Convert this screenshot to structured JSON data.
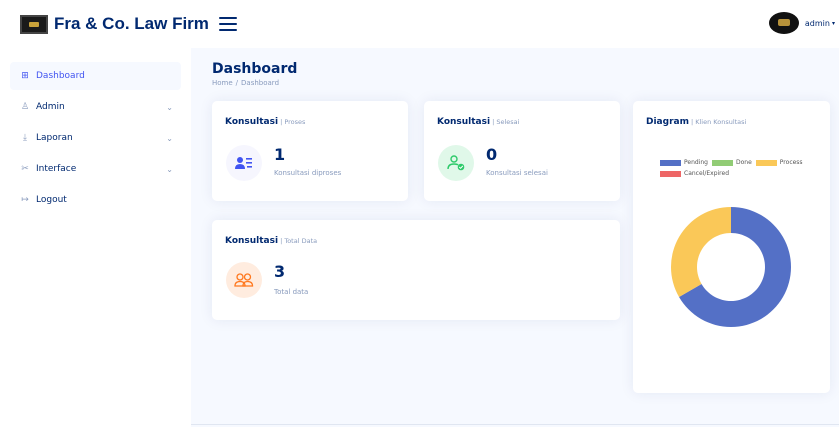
{
  "header": {
    "brand": "Fra & Co. Law Firm",
    "user": "admin",
    "user_caret": "▾"
  },
  "sidebar": {
    "items": [
      {
        "icon": "⊞",
        "label": "Dashboard",
        "chevron": ""
      },
      {
        "icon": "♙",
        "label": "Admin",
        "chevron": "⌄"
      },
      {
        "icon": "⤓",
        "label": "Laporan",
        "chevron": "⌄"
      },
      {
        "icon": "✂",
        "label": "Interface",
        "chevron": "⌄"
      },
      {
        "icon": "↦",
        "label": "Logout",
        "chevron": ""
      }
    ]
  },
  "page": {
    "title": "Dashboard",
    "breadcrumb": {
      "home": "Home",
      "sep": "/",
      "current": "Dashboard"
    }
  },
  "cards": {
    "proses": {
      "title": "Konsultasi",
      "subtitle": "| Proses",
      "value": "1",
      "desc": "Konsultasi diproses",
      "icon": "person-list-icon"
    },
    "selesai": {
      "title": "Konsultasi",
      "subtitle": "| Selesai",
      "value": "0",
      "desc": "Konsultasi selesai",
      "icon": "person-check-icon"
    },
    "total": {
      "title": "Konsultasi",
      "subtitle": "| Total Data",
      "value": "3",
      "desc": "Total data",
      "icon": "people-icon"
    }
  },
  "diagram": {
    "title": "Diagram",
    "subtitle": "| Klien Konsultasi",
    "legend": [
      {
        "label": "Pending",
        "color": "#5470c6"
      },
      {
        "label": "Done",
        "color": "#91cc75"
      },
      {
        "label": "Process",
        "color": "#fac858"
      },
      {
        "label": "Cancel/Expired",
        "color": "#ee6666"
      }
    ]
  },
  "chart_data": {
    "type": "pie",
    "categories": [
      "Pending",
      "Done",
      "Process",
      "Cancel/Expired"
    ],
    "values": [
      2,
      0,
      1,
      0
    ],
    "colors": [
      "#5470c6",
      "#91cc75",
      "#fac858",
      "#ee6666"
    ],
    "donut": true,
    "legend_position": "top-left"
  }
}
